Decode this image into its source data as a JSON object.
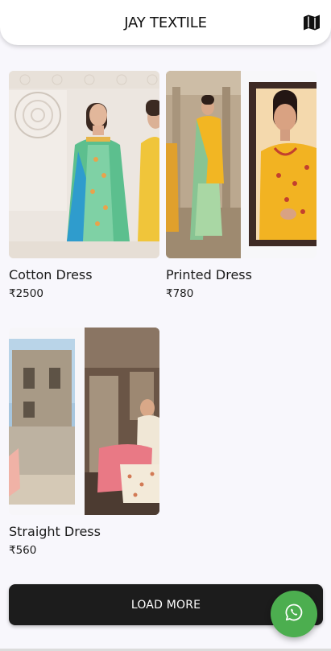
{
  "app_bar": {
    "title": "JAY TEXTILE",
    "map_icon": "map-icon"
  },
  "products": [
    {
      "name": "Cotton Dress",
      "price": "₹2500"
    },
    {
      "name": "Printed Dress",
      "price": "₹780"
    },
    {
      "name": "Straight Dress",
      "price": "₹560"
    }
  ],
  "load_more_label": "LOAD MORE",
  "whatsapp_icon": "whatsapp-icon",
  "colors": {
    "background": "#f8f7fc",
    "button_dark": "#1c1c1c",
    "whatsapp_green": "#4cae4f"
  }
}
